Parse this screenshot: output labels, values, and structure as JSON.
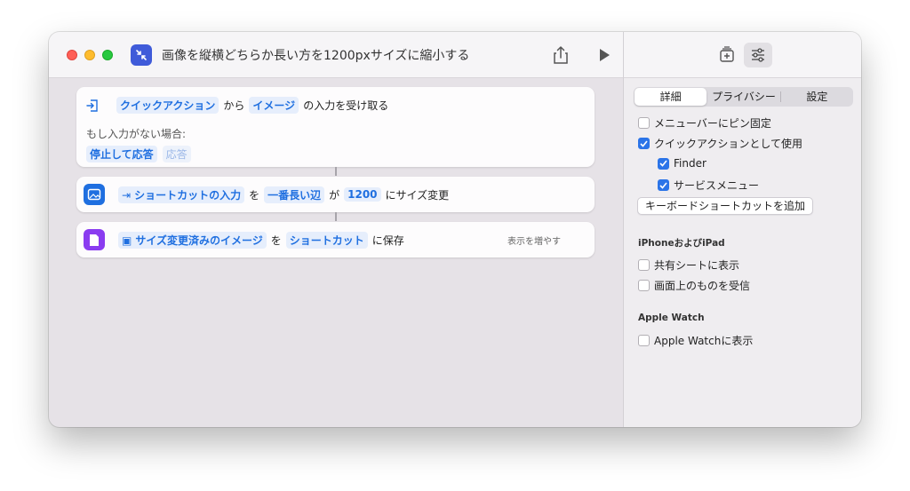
{
  "window": {
    "title": "画像を縦横どちらか長い方を1200pxサイズに縮小する",
    "app_icon": "shrink-arrows-icon",
    "accent": "#3f5bd9"
  },
  "toolbar": {
    "share_icon": "share-icon",
    "run_icon": "play-icon",
    "library_icon": "library-add-icon",
    "details_icon": "sliders-icon"
  },
  "actions": [
    {
      "line": {
        "token1": "クイックアクション",
        "text1": "から",
        "token2": "イメージ",
        "text2": "の入力を受け取る"
      },
      "fallback_label": "もし入力がない場合:",
      "fallback_choice": "停止して応答",
      "fallback_extra": "応答"
    },
    {
      "token_input": "ショートカットの入力",
      "text1": "を",
      "token_edge": "一番長い辺",
      "text2": "が",
      "token_size": "1200",
      "text3": "にサイズ変更",
      "icon_color": "#1f6fe0"
    },
    {
      "token_image": "サイズ変更済みのイメージ",
      "text1": "を",
      "token_dest": "ショートカット",
      "text2": "に保存",
      "show_more": "表示を増やす",
      "icon_color": "#8a3cf0"
    }
  ],
  "sidebar": {
    "tabs": [
      "詳細",
      "プライバシー",
      "設定"
    ],
    "active_tab": "詳細",
    "options": {
      "pin_menubar": {
        "label": "メニューバーにピン固定",
        "checked": false
      },
      "quick_action": {
        "label": "クイックアクションとして使用",
        "checked": true
      },
      "finder": {
        "label": "Finder",
        "checked": true
      },
      "services": {
        "label": "サービスメニュー",
        "checked": true
      }
    },
    "keyboard_button": "キーボードショートカットを追加",
    "iphone_section": {
      "title": "iPhoneおよびiPad",
      "share_sheet": {
        "label": "共有シートに表示",
        "checked": false
      },
      "receive_screen": {
        "label": "画面上のものを受信",
        "checked": false
      }
    },
    "watch_section": {
      "title": "Apple Watch",
      "show_watch": {
        "label": "Apple Watchに表示",
        "checked": false
      }
    }
  }
}
